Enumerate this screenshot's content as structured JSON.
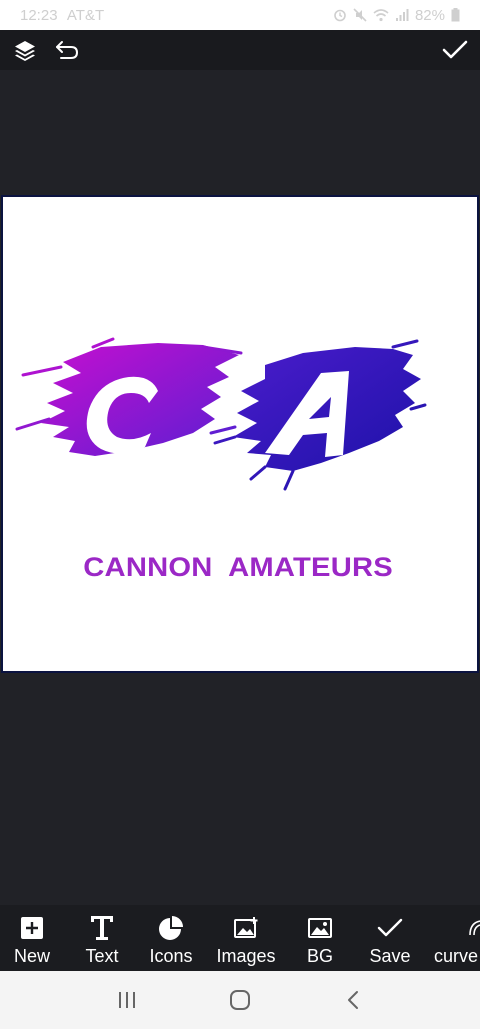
{
  "status_bar": {
    "time": "12:23",
    "carrier": "AT&T",
    "battery": "82%"
  },
  "top_toolbar": {
    "layers_icon": "layers-icon",
    "undo_icon": "undo-icon",
    "confirm_icon": "check-icon"
  },
  "canvas": {
    "logo_letters": [
      "C",
      "A"
    ],
    "brand_word_1": "CANNON",
    "brand_word_2": "AMATEURS",
    "colors": {
      "magenta": "#b20fd0",
      "violet": "#6a1bd6",
      "indigo": "#2a14b4",
      "text": "#9b28c6",
      "border": "#0b1340"
    }
  },
  "bottom_toolbar": {
    "tools": [
      {
        "label": "New",
        "icon": "plus-square-icon"
      },
      {
        "label": "Text",
        "icon": "text-t-icon"
      },
      {
        "label": "Icons",
        "icon": "pie-icon"
      },
      {
        "label": "Images",
        "icon": "image-add-icon"
      },
      {
        "label": "BG",
        "icon": "image-icon"
      },
      {
        "label": "Save",
        "icon": "check-icon"
      },
      {
        "label": "curve",
        "icon": "curve-icon"
      }
    ]
  },
  "nav_bar": {
    "recents_icon": "recents-icon",
    "home_icon": "home-icon",
    "back_icon": "back-icon"
  }
}
